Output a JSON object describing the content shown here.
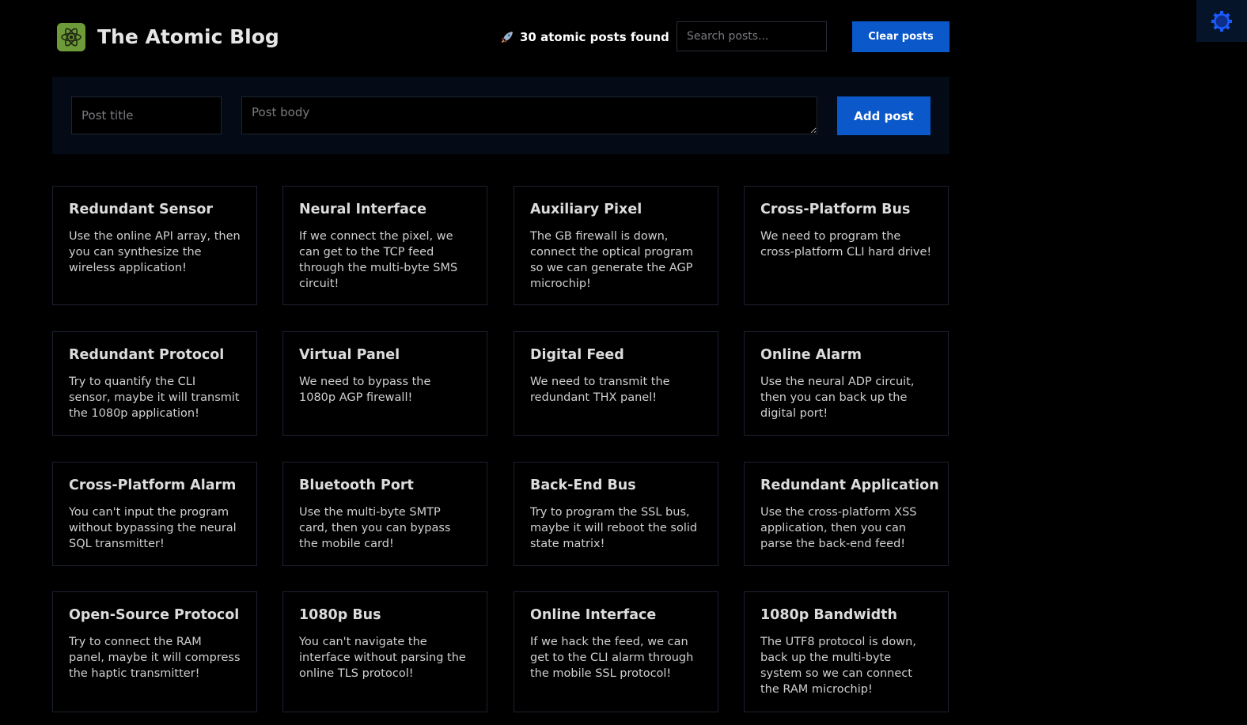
{
  "header": {
    "app_title": "The Atomic Blog",
    "post_count_text": "30 atomic posts found",
    "search_placeholder": "Search posts...",
    "clear_label": "Clear posts"
  },
  "form": {
    "title_placeholder": "Post title",
    "body_placeholder": "Post body",
    "add_label": "Add post"
  },
  "colors": {
    "background": "#000000",
    "accent_button": "#0a58ca",
    "logo_bg": "#6e9a3a",
    "form_panel": "#040b16",
    "card_border": "#1c2130"
  },
  "icons": {
    "logo": "atom-icon",
    "count": "rocket-icon",
    "corner": "gear-icon"
  },
  "posts": [
    {
      "title": "Redundant Sensor",
      "body": "Use the online API array, then you can synthesize the wireless application!"
    },
    {
      "title": "Neural Interface",
      "body": "If we connect the pixel, we can get to the TCP feed through the multi-byte SMS circuit!"
    },
    {
      "title": "Auxiliary Pixel",
      "body": "The GB firewall is down, connect the optical program so we can generate the AGP microchip!"
    },
    {
      "title": "Cross-Platform Bus",
      "body": "We need to program the cross-platform CLI hard drive!"
    },
    {
      "title": "Redundant Protocol",
      "body": "Try to quantify the CLI sensor, maybe it will transmit the 1080p application!"
    },
    {
      "title": "Virtual Panel",
      "body": "We need to bypass the 1080p AGP firewall!"
    },
    {
      "title": "Digital Feed",
      "body": "We need to transmit the redundant THX panel!"
    },
    {
      "title": "Online Alarm",
      "body": "Use the neural ADP circuit, then you can back up the digital port!"
    },
    {
      "title": "Cross-Platform Alarm",
      "body": "You can't input the program without bypassing the neural SQL transmitter!"
    },
    {
      "title": "Bluetooth Port",
      "body": "Use the multi-byte SMTP card, then you can bypass the mobile card!"
    },
    {
      "title": "Back-End Bus",
      "body": "Try to program the SSL bus, maybe it will reboot the solid state matrix!"
    },
    {
      "title": "Redundant Application",
      "body": "Use the cross-platform XSS application, then you can parse the back-end feed!"
    },
    {
      "title": "Open-Source Protocol",
      "body": "Try to connect the RAM panel, maybe it will compress the haptic transmitter!"
    },
    {
      "title": "1080p Bus",
      "body": "You can't navigate the interface without parsing the online TLS protocol!"
    },
    {
      "title": "Online Interface",
      "body": "If we hack the feed, we can get to the CLI alarm through the mobile SSL protocol!"
    },
    {
      "title": "1080p Bandwidth",
      "body": "The UTF8 protocol is down, back up the multi-byte system so we can connect the RAM microchip!"
    }
  ]
}
